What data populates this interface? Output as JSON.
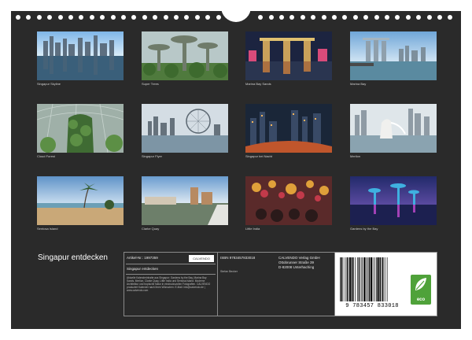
{
  "calendar": {
    "title": "Singapur entdecken"
  },
  "photos": [
    {
      "caption": "Singapur Skyline",
      "scene": "skyline-reflection"
    },
    {
      "caption": "Super Trees",
      "scene": "supertrees"
    },
    {
      "caption": "Marina Bay Sands",
      "scene": "marina-bay-sands-night"
    },
    {
      "caption": "Marina Bay",
      "scene": "marina-bay-day"
    },
    {
      "caption": "Cloud Forest",
      "scene": "cloud-forest"
    },
    {
      "caption": "Singapur Flyer",
      "scene": "flyer"
    },
    {
      "caption": "Singapur bei Nacht",
      "scene": "city-night"
    },
    {
      "caption": "Merlion",
      "scene": "merlion"
    },
    {
      "caption": "Sentosa Island",
      "scene": "beach"
    },
    {
      "caption": "Clarke Quay",
      "scene": "quay"
    },
    {
      "caption": "Little India",
      "scene": "little-india"
    },
    {
      "caption": "Gardens by the Bay",
      "scene": "gardens-night"
    }
  ],
  "info": {
    "article": "Artikel-Nr.: 1997359",
    "publisher_logo": "CALVENDO",
    "subtitle": "Singapur entdecken",
    "description": "Aktuelle Kalenderinhalte aus Singapur: Gardens by the Bay, Marina Bay Sands, Merlion, Clarke Quay, Little India und Sentosa Island. Moderne Architektur und tropische Natur in eindrucksvollen Fotografien. CALVENDO produziert Kalender nach Ihren Wünschen. E-Mail: info@calvendo.de | www.calvendo.com",
    "isbn": "ISBN 9783457833018",
    "author": "Stefan Becker",
    "address_1": "CALVENDO Verlag GmbH",
    "address_2": "Ottobrunner Straße 39",
    "address_3": "D-82008 Unterhaching",
    "barcode_number": "9 783457 833018",
    "eco_label": "eco"
  }
}
